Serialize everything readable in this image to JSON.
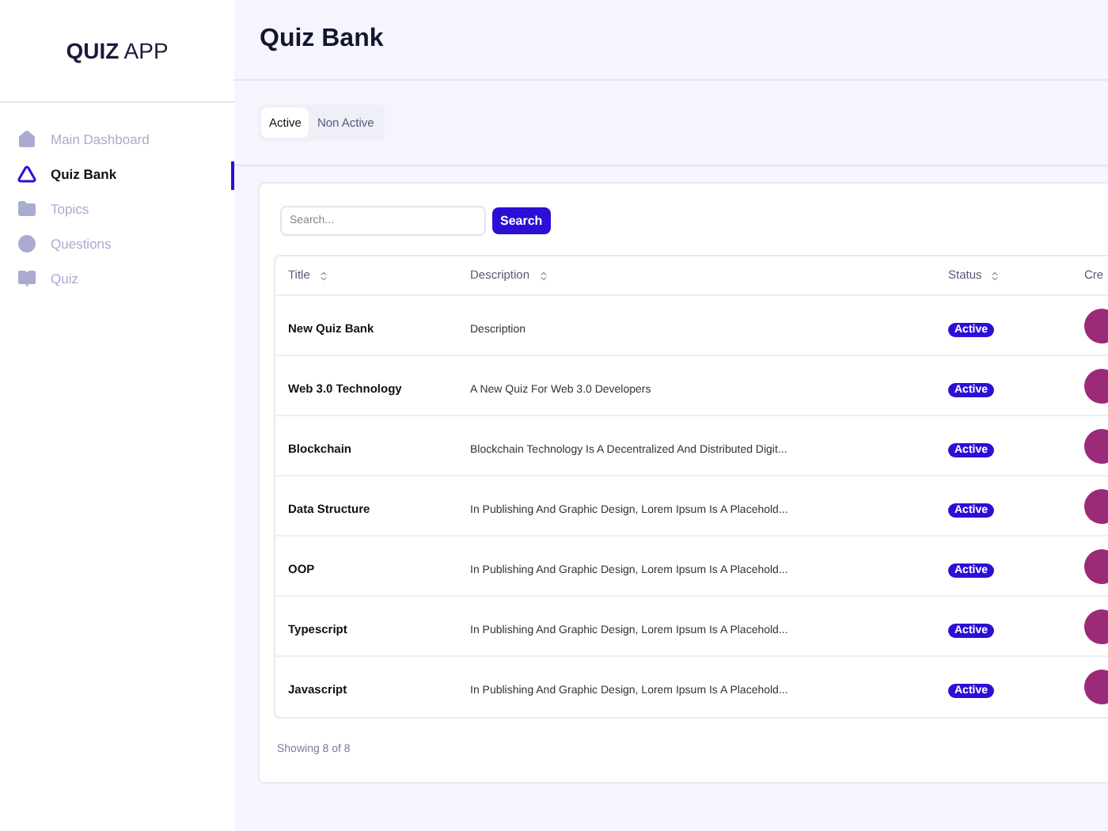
{
  "brand": {
    "bold": "QUIZ",
    "light": "APP"
  },
  "sidebar": {
    "items": [
      {
        "label": "Main Dashboard",
        "selected": false
      },
      {
        "label": "Quiz Bank",
        "selected": true
      },
      {
        "label": "Topics",
        "selected": false
      },
      {
        "label": "Questions",
        "selected": false
      },
      {
        "label": "Quiz",
        "selected": false
      }
    ]
  },
  "page_title": "Quiz Bank",
  "tabs": [
    {
      "label": "Active",
      "selected": true
    },
    {
      "label": "Non Active",
      "selected": false
    }
  ],
  "search": {
    "placeholder": "Search...",
    "button": "Search"
  },
  "table": {
    "columns": [
      {
        "label": "Title"
      },
      {
        "label": "Description"
      },
      {
        "label": "Status"
      },
      {
        "label": "Cre"
      }
    ],
    "rows": [
      {
        "title": "New Quiz Bank",
        "description": "Description",
        "status": "Active"
      },
      {
        "title": "Web 3.0 Technology",
        "description": "A New Quiz For Web 3.0 Developers",
        "status": "Active"
      },
      {
        "title": "Blockchain",
        "description": "Blockchain Technology Is A Decentralized And Distributed Digit...",
        "status": "Active"
      },
      {
        "title": "Data Structure",
        "description": "In Publishing And Graphic Design, Lorem Ipsum Is A Placehold...",
        "status": "Active"
      },
      {
        "title": "OOP",
        "description": "In Publishing And Graphic Design, Lorem Ipsum Is A Placehold...",
        "status": "Active"
      },
      {
        "title": "Typescript",
        "description": "In Publishing And Graphic Design, Lorem Ipsum Is A Placehold...",
        "status": "Active"
      },
      {
        "title": "Javascript",
        "description": "In Publishing And Graphic Design, Lorem Ipsum Is A Placehold...",
        "status": "Active"
      }
    ]
  },
  "footer": "Showing 8 of 8"
}
